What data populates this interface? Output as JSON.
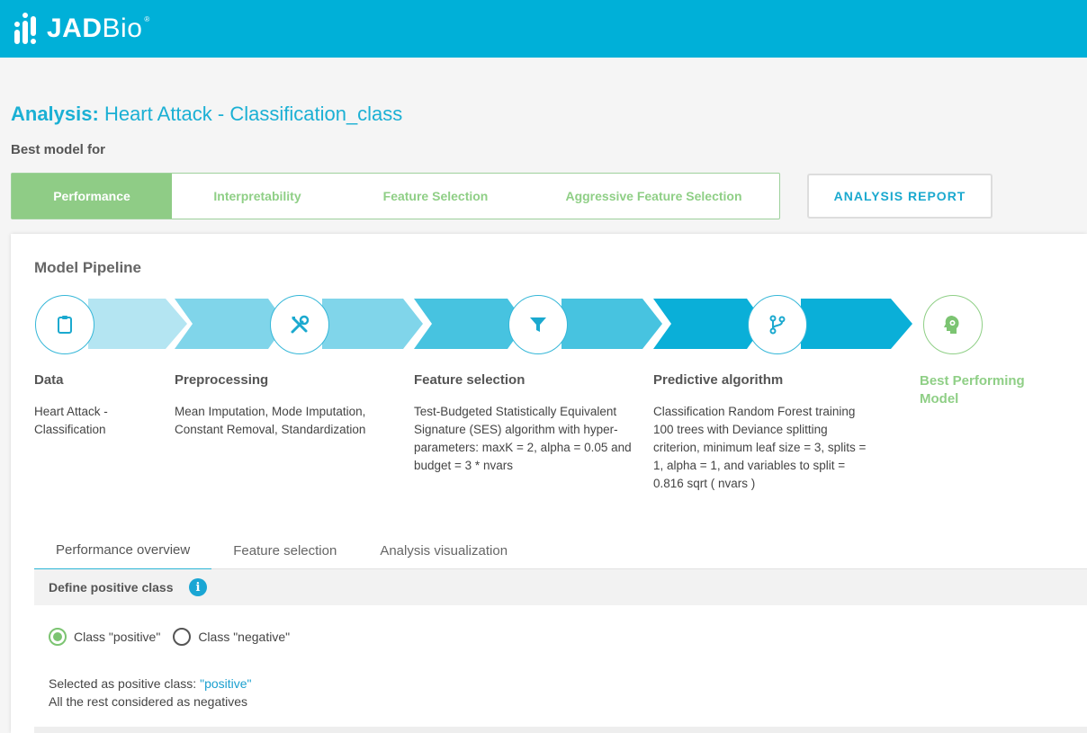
{
  "header": {
    "logo_main": "JAD",
    "logo_sub": "Bio",
    "logo_reg": "®",
    "bg_color": "#00b0d8"
  },
  "analysis": {
    "prefix": "Analysis:",
    "name": "Heart Attack - Classification_class",
    "best_model_for": "Best model for"
  },
  "model_tabs": [
    {
      "label": "Performance",
      "active": true
    },
    {
      "label": "Interpretability",
      "active": false
    },
    {
      "label": "Feature Selection",
      "active": false
    },
    {
      "label": "Aggressive Feature Selection",
      "active": false
    }
  ],
  "report_button": "ANALYSIS REPORT",
  "pipeline": {
    "title": "Model Pipeline",
    "steps": [
      {
        "icon": "clipboard-icon",
        "title": "Data",
        "text": "Heart Attack -\nClassification"
      },
      {
        "icon": "tools-icon",
        "title": "Preprocessing",
        "text": "Mean Imputation, Mode Imputation,\nConstant Removal, Standardization"
      },
      {
        "icon": "filter-icon",
        "title": "Feature selection",
        "text": "Test-Budgeted Statistically Equivalent\nSignature (SES) algorithm with hyper-\nparameters: maxK = 2, alpha = 0.05 and\nbudget = 3 * nvars"
      },
      {
        "icon": "branch-icon",
        "title": "Predictive algorithm",
        "text": "Classification Random Forest training\n100 trees with Deviance splitting\ncriterion, minimum leaf size = 3, splits =\n1, alpha = 1, and variables to split =\n0.816 sqrt ( nvars )"
      },
      {
        "icon": "head-gear-icon",
        "title": "Best Performing\nModel",
        "text": ""
      }
    ]
  },
  "lower_tabs": [
    {
      "label": "Performance overview",
      "active": true
    },
    {
      "label": "Feature selection",
      "active": false
    },
    {
      "label": "Analysis visualization",
      "active": false
    }
  ],
  "positive_class": {
    "label": "Define positive class",
    "info": "i",
    "options": [
      {
        "label": "Class \"positive\"",
        "checked": true
      },
      {
        "label": "Class \"negative\"",
        "checked": false
      }
    ],
    "selected_prefix": "Selected as positive class:",
    "selected_value": "\"positive\"",
    "rest_note": "All the rest considered as negatives"
  }
}
